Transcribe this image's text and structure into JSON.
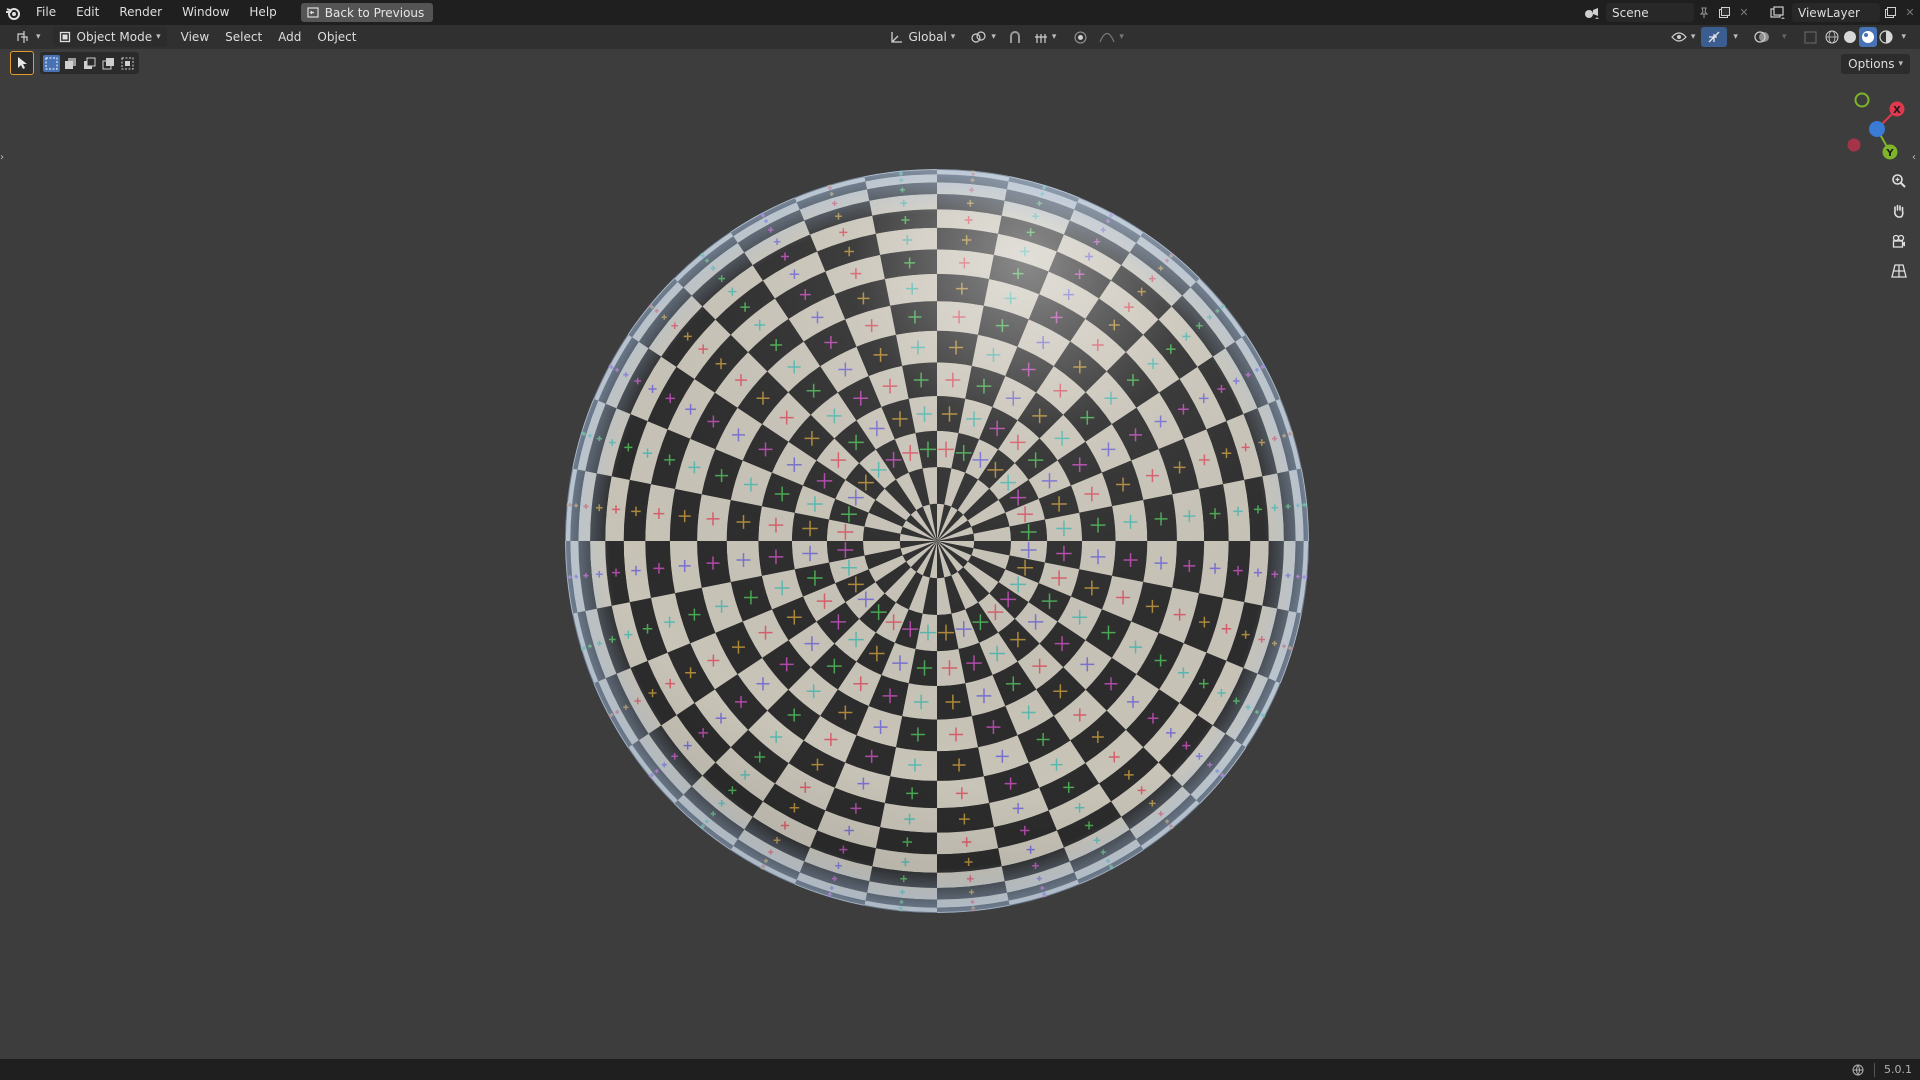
{
  "topbar": {
    "menu": [
      "File",
      "Edit",
      "Render",
      "Window",
      "Help"
    ],
    "back_button": "Back to Previous",
    "scene_name": "Scene",
    "view_layer": "ViewLayer",
    "icons": [
      "blender-logo-icon",
      "scene-icon",
      "pin-icon",
      "new-scene-icon",
      "close-icon",
      "view-layer-icon",
      "new-layer-icon"
    ]
  },
  "header": {
    "mode": "Object Mode",
    "menus": [
      "View",
      "Select",
      "Add",
      "Object"
    ],
    "transform_orientation": "Global",
    "options_label": "Options",
    "icons": [
      "editor-type-icon",
      "pivot-icon",
      "snap-icon",
      "proportional-icon",
      "overlay-icon",
      "gizmo-icon",
      "xray-icon",
      "wireframe-shading-icon",
      "solid-shading-icon",
      "material-shading-icon",
      "rendered-shading-icon"
    ]
  },
  "gizmo": {
    "x_label": "X",
    "y_label": "Y",
    "colors": {
      "x": "#e0394d",
      "y": "#7fb52a",
      "z": "#3a7bd5"
    }
  },
  "statusbar": {
    "version": "5.0.1"
  },
  "viewport": {
    "background": "#3d3d3d",
    "object": "UV sphere with checker texture",
    "checker_colors": [
      "#c9c4b8",
      "#2c2c2c"
    ]
  }
}
